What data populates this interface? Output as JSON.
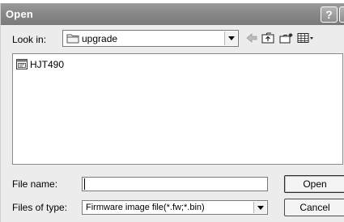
{
  "window": {
    "title": "Open",
    "help_glyph": "?",
    "close_glyph": "X"
  },
  "lookin": {
    "label": "Look in:",
    "value": "upgrade",
    "icon": "folder-icon"
  },
  "toolbar": {
    "icons": [
      "back-arrow-icon",
      "up-folder-icon",
      "new-folder-icon",
      "view-menu-icon"
    ]
  },
  "files": [
    {
      "name": "HJT490",
      "icon": "firmware-file-icon"
    }
  ],
  "filename": {
    "label": "File name:",
    "value": "",
    "placeholder": ""
  },
  "filetype": {
    "label": "Files of type:",
    "value": "Firmware image file(*.fw;*.bin)"
  },
  "buttons": {
    "open": "Open",
    "cancel": "Cancel"
  },
  "colors": {
    "titlebar": "#8a8a8a",
    "dialog_bg": "#ececec",
    "panel_bg": "#ffffff"
  }
}
